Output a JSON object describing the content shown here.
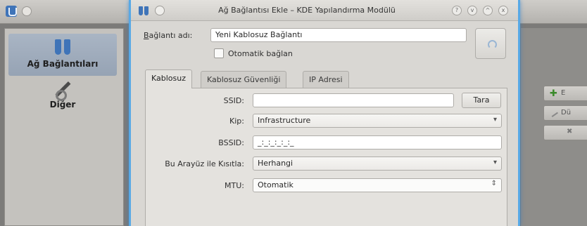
{
  "background": {
    "sidebar": {
      "items": [
        {
          "label": "Ağ Bağlantıları",
          "icon": "network-connections-icon"
        },
        {
          "label": "Diğer",
          "icon": "tools-icon"
        }
      ]
    },
    "right_buttons": [
      {
        "label": "E",
        "icon": "add-icon"
      },
      {
        "label": "Dü",
        "icon": "edit-icon"
      },
      {
        "label": "",
        "icon": "remove-icon"
      }
    ]
  },
  "dialog": {
    "title": "Ağ Bağlantısı Ekle – KDE Yapılandırma Modülü",
    "window_buttons": {
      "help": "?",
      "minimize": "v",
      "maximize": "^",
      "close": "x"
    },
    "connection_name": {
      "label_u": "B",
      "label_rest": "ağlantı adı:",
      "value": "Yeni Kablosuz Bağlantı"
    },
    "autoconnect": {
      "label": "Otomatik bağlan",
      "checked": false
    },
    "tabs": [
      {
        "label": "Kablosuz",
        "active": true
      },
      {
        "label": "Kablosuz Güvenliği",
        "active": false
      },
      {
        "label": "IP Adresi",
        "active": false
      }
    ],
    "fields": {
      "ssid": {
        "label": "SSID:",
        "value": "",
        "scan_button": "Tara"
      },
      "mode": {
        "label": "Kip:",
        "value": "Infrastructure"
      },
      "bssid": {
        "label": "BSSID:",
        "value": "_:_:_:_:_:_"
      },
      "restrict": {
        "label": "Bu Arayüz ile Kısıtla:",
        "value": "Herhangi"
      },
      "mtu": {
        "label": "MTU:",
        "value": "Otomatik"
      }
    }
  }
}
